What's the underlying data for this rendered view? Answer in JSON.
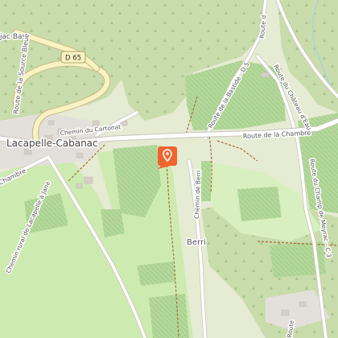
{
  "map": {
    "labels": {
      "place_partial": "jac Bas",
      "village": "Lacapelle-Cabanac",
      "hamlet": "Berri",
      "road_d65": "D 65",
      "road_source_bleue": "Route de la Source Bleue",
      "road_chambre_east": "Route de la Chambre",
      "road_chambre_west": "Chambre",
      "chemin_cartonat": "Chemin du Cartonat",
      "chemin_berri": "Chemin de Berri",
      "route_bastide": "Route de la Bastide - D 5",
      "route_chateau_eau": "Route du Château d'Eau",
      "route_champ_meyrac": "Route du Champ de Meyrac - C 3",
      "chemin_rural": "Chemin rural de Lacapelle à Jane",
      "route_partial_top": "Route d",
      "route_partial_bottom": "Route"
    },
    "marker": {
      "icon": "map-pin-icon",
      "color": "#f0642d"
    },
    "colors": {
      "forest": "#c9dcab",
      "meadow": "#cdebb0",
      "vineyard": "#b4d89b",
      "road": "#ffffff",
      "road_major": "#f9f2c3",
      "track": "#a9692f",
      "river": "#aad3df"
    }
  }
}
